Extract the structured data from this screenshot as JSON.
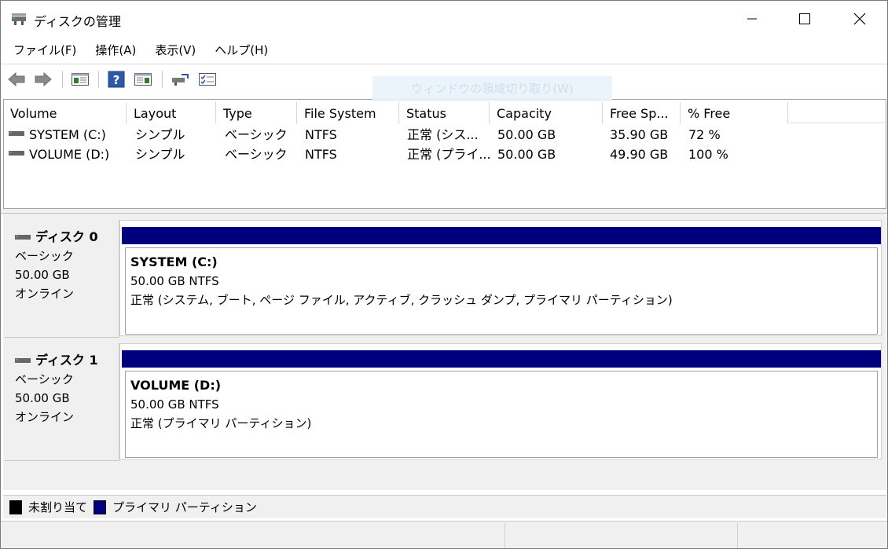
{
  "window": {
    "title": "ディスクの管理"
  },
  "menu": [
    "ファイル(F)",
    "操作(A)",
    "表示(V)",
    "ヘルプ(H)"
  ],
  "toolbar": {
    "buttons": [
      "back-arrow-icon",
      "forward-arrow-icon",
      "console-tree-icon",
      "help-icon",
      "action-pane-icon",
      "connect-disk-icon",
      "properties-list-icon"
    ],
    "ghost_tooltip": "ウィンドウの領域切り取り(W)"
  },
  "volume_list": {
    "columns": [
      "Volume",
      "Layout",
      "Type",
      "File System",
      "Status",
      "Capacity",
      "Free Sp...",
      "% Free"
    ],
    "rows": [
      {
        "volume": "SYSTEM (C:)",
        "layout": "シンプル",
        "type": "ベーシック",
        "fs": "NTFS",
        "status": "正常 (シス...",
        "capacity": "50.00 GB",
        "free": "35.90 GB",
        "pct": "72 %"
      },
      {
        "volume": "VOLUME (D:)",
        "layout": "シンプル",
        "type": "ベーシック",
        "fs": "NTFS",
        "status": "正常 (プライ...",
        "capacity": "50.00 GB",
        "free": "49.90 GB",
        "pct": "100 %"
      }
    ]
  },
  "disks": [
    {
      "name": "ディスク 0",
      "type": "ベーシック",
      "size": "50.00 GB",
      "state": "オンライン",
      "partition": {
        "title": "SYSTEM  (C:)",
        "size_fs": "50.00 GB NTFS",
        "status": "正常 (システム, ブート, ページ ファイル, アクティブ, クラッシュ ダンプ, プライマリ パーティション)"
      }
    },
    {
      "name": "ディスク 1",
      "type": "ベーシック",
      "size": "50.00 GB",
      "state": "オンライン",
      "partition": {
        "title": "VOLUME  (D:)",
        "size_fs": "50.00 GB NTFS",
        "status": "正常 (プライマリ パーティション)"
      }
    }
  ],
  "legend": [
    {
      "label": "未割り当て",
      "color": "#000000"
    },
    {
      "label": "プライマリ パーティション",
      "color": "#00007f"
    }
  ],
  "colors": {
    "primary_partition": "#00007f",
    "unallocated": "#000000"
  }
}
